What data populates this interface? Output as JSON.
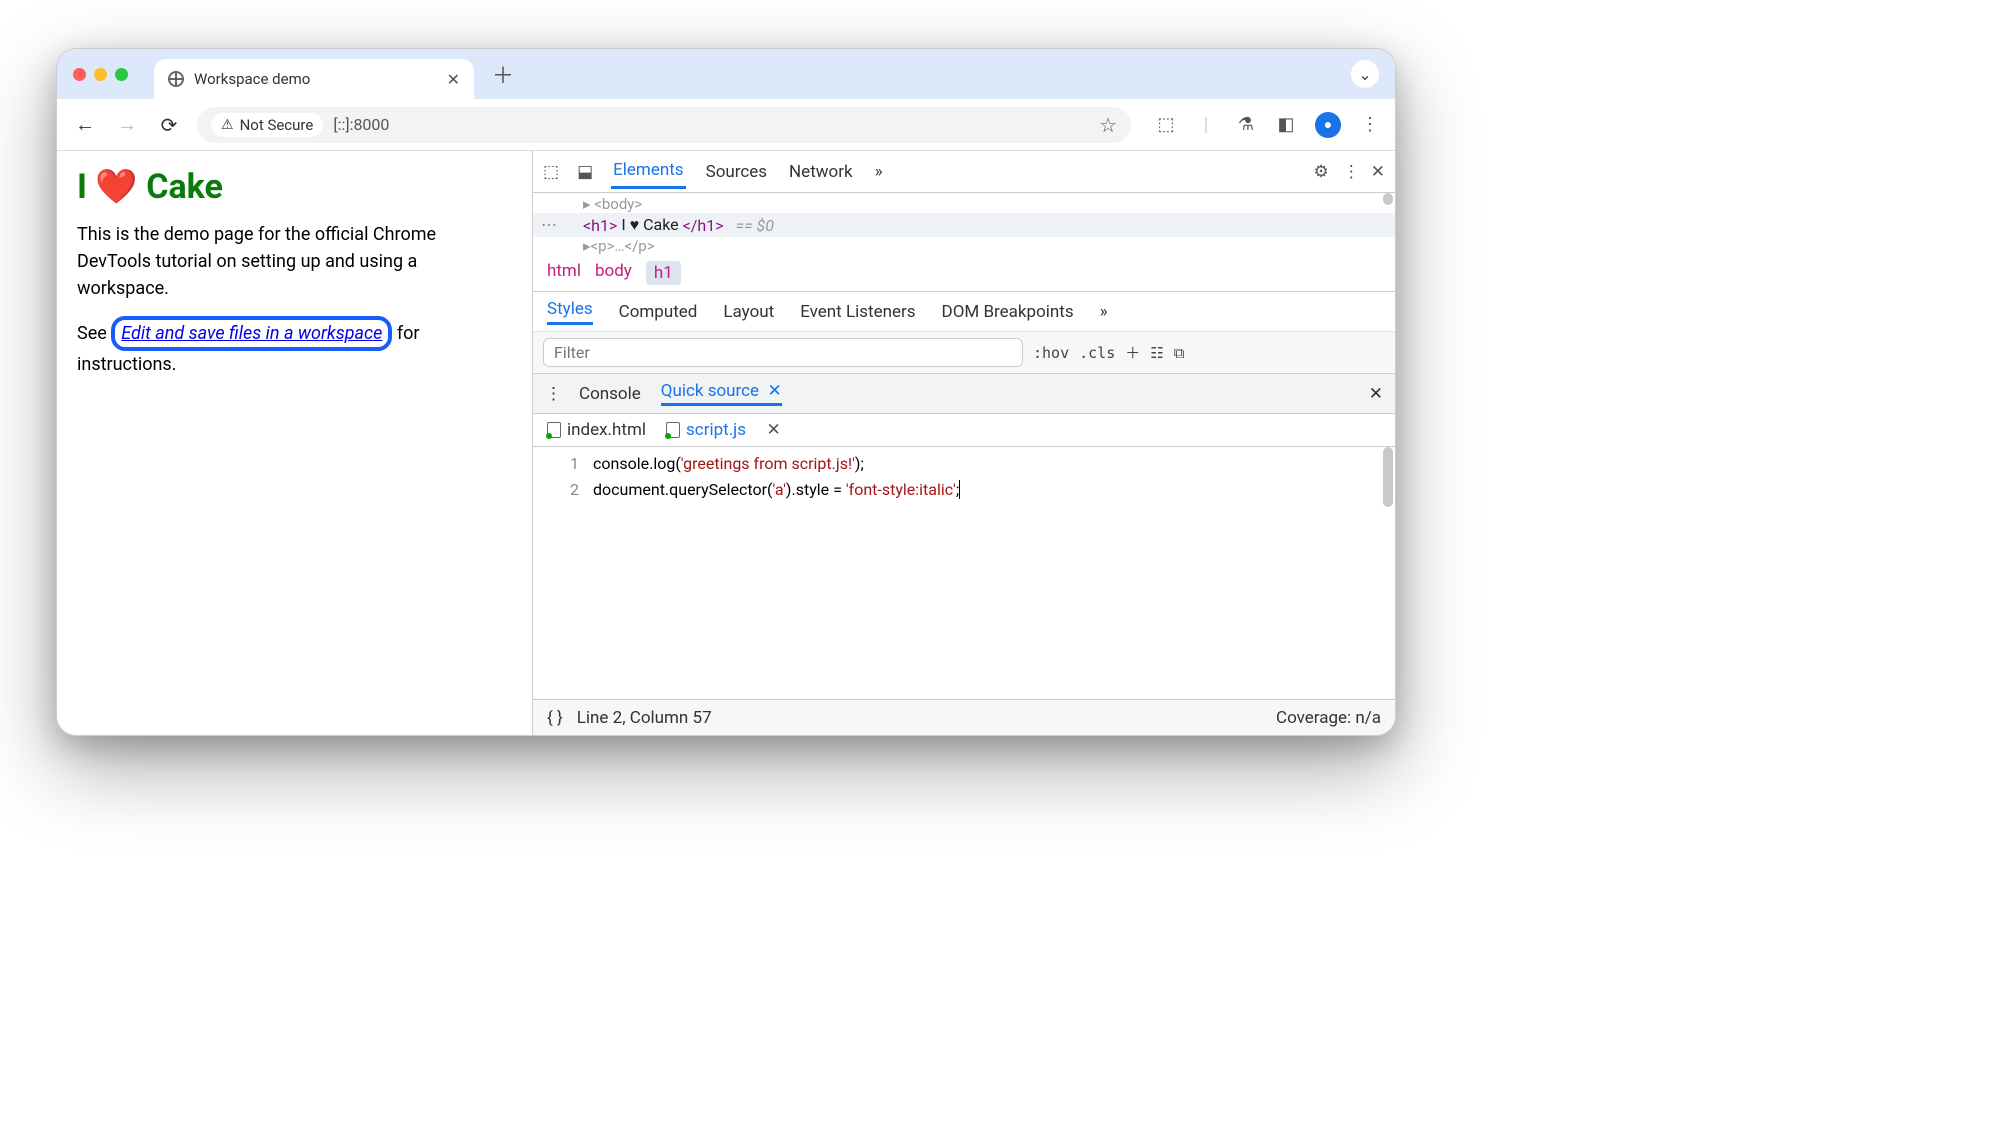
{
  "browser": {
    "tabTitle": "Workspace demo",
    "addressBar": {
      "securityLabel": "Not Secure",
      "url": "[::]:8000"
    }
  },
  "page": {
    "h1_pre": "I ",
    "h1_heart": "❤️",
    "h1_post": " Cake",
    "para1": "This is the demo page for the official Chrome DevTools tutorial on setting up and using a workspace.",
    "para2_pre": "See ",
    "para2_link": "Edit and save files in a workspace",
    "para2_post": " for instructions."
  },
  "devtools": {
    "mainTabs": [
      "Elements",
      "Sources",
      "Network"
    ],
    "mainMore": "»",
    "dom": {
      "fadedAbove": "▸ <body>",
      "line": {
        "open": "<h1>",
        "text": "I ♥ Cake",
        "close": "</h1>",
        "suffix": "== $0"
      },
      "fadedBelow": "▸<p>…</p>"
    },
    "breadcrumb": [
      "html",
      "body",
      "h1"
    ],
    "stylesTabs": [
      "Styles",
      "Computed",
      "Layout",
      "Event Listeners",
      "DOM Breakpoints"
    ],
    "stylesMore": "»",
    "filterPlaceholder": "Filter",
    "filterButtons": {
      "hov": ":hov",
      "cls": ".cls"
    },
    "drawerTabs": [
      "Console",
      "Quick source"
    ],
    "files": [
      "index.html",
      "script.js"
    ],
    "code": {
      "lines": [
        1,
        2
      ],
      "l1_a": "console.log(",
      "l1_s": "'greetings from script.js!'",
      "l1_b": ");",
      "l2_a": "document.querySelector(",
      "l2_s": "'a'",
      "l2_b": ").style = ",
      "l2_s2": "'font-style:italic'",
      "l2_c": ";"
    },
    "status": {
      "pos": "Line 2, Column 57",
      "coverage": "Coverage: n/a"
    }
  }
}
